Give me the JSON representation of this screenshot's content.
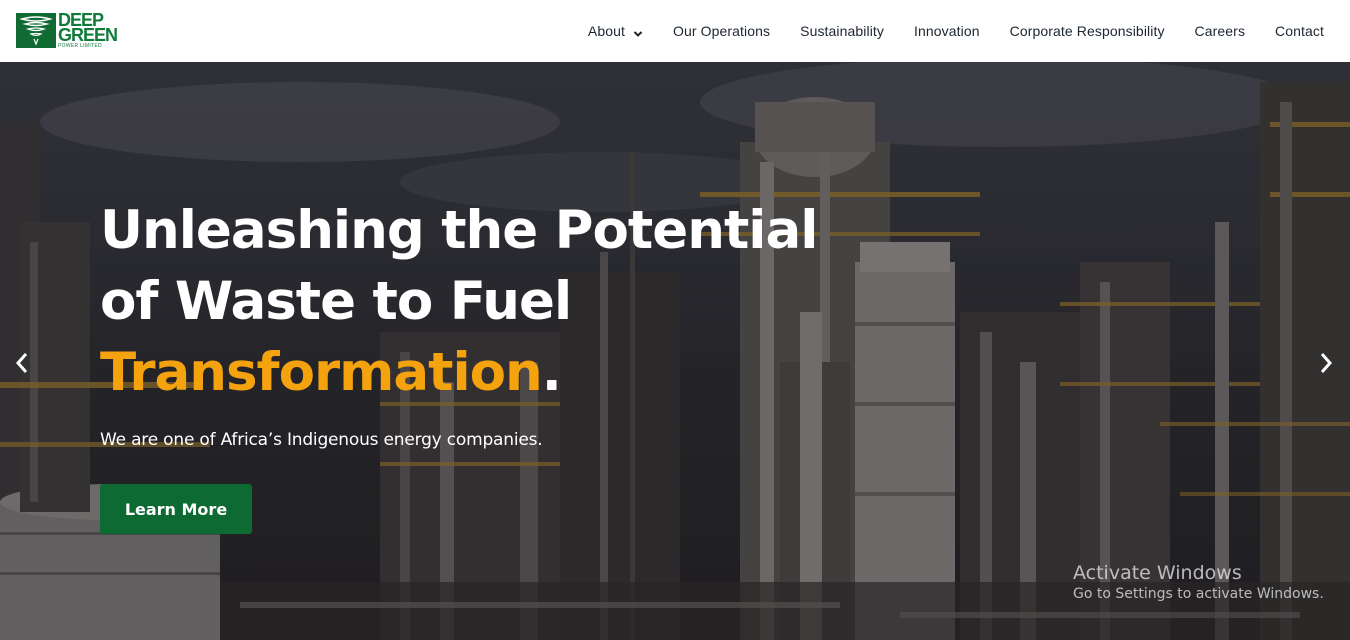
{
  "logo": {
    "line1": "DEEP",
    "line2": "GREEN",
    "line3": "POWER LIMITED"
  },
  "nav": {
    "items": [
      {
        "label": "About"
      },
      {
        "label": "Our Operations"
      },
      {
        "label": "Sustainability"
      },
      {
        "label": "Innovation"
      },
      {
        "label": "Corporate Responsibility"
      },
      {
        "label": "Careers"
      },
      {
        "label": "Contact"
      }
    ]
  },
  "hero": {
    "headline_line1": "Unleashing the Potential",
    "headline_line2": "of Waste to Fuel",
    "headline_accent": "Transformation",
    "headline_period": ".",
    "subtitle": "We are one of Africa’s Indigenous energy companies.",
    "button_label": "Learn More"
  },
  "watermark": {
    "title": "Activate Windows",
    "subtitle": "Go to Settings to activate Windows."
  },
  "colors": {
    "brand_green": "#0e6a33",
    "accent_orange": "#f4a20e",
    "nav_text": "#1d2630"
  },
  "icons": {
    "about_dropdown": "chevron-down-icon",
    "slider_prev": "chevron-left-icon",
    "slider_next": "chevron-right-icon"
  }
}
